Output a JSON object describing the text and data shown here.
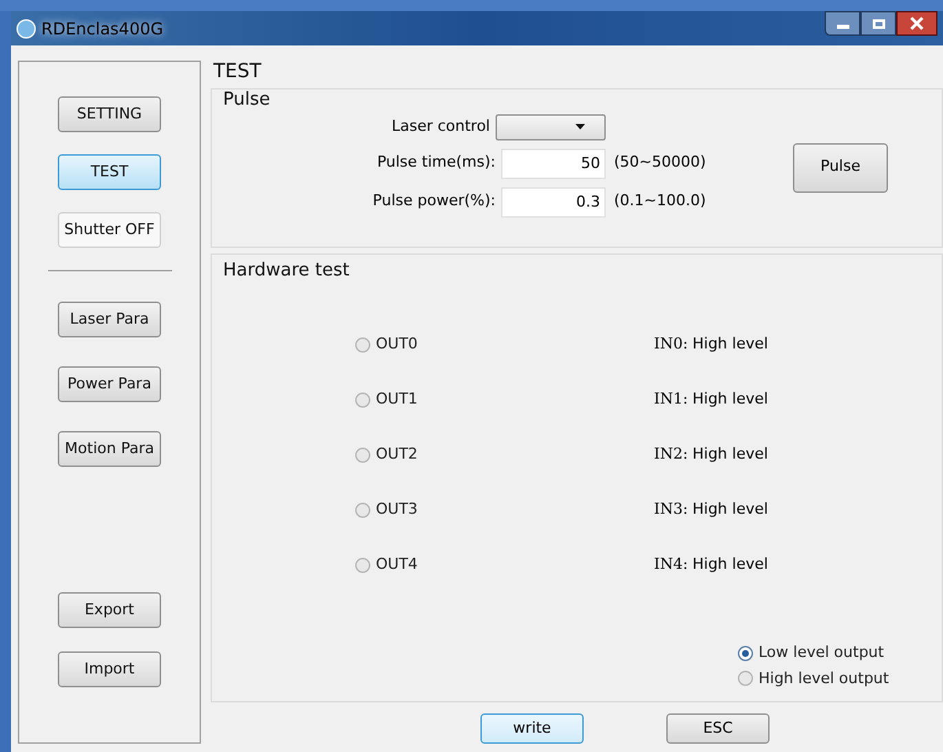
{
  "window": {
    "title": "RDEnclas400G"
  },
  "sidebar": {
    "groups": [
      [
        {
          "label": "SETTING",
          "selected": false,
          "kind": "button"
        },
        {
          "label": "TEST",
          "selected": true,
          "kind": "button"
        },
        {
          "label": "Shutter OFF",
          "selected": false,
          "kind": "flat"
        }
      ],
      [
        {
          "label": "Laser Para",
          "selected": false,
          "kind": "button"
        },
        {
          "label": "Power Para",
          "selected": false,
          "kind": "button"
        },
        {
          "label": "Motion Para",
          "selected": false,
          "kind": "button"
        }
      ],
      [
        {
          "label": "Export",
          "selected": false,
          "kind": "button"
        },
        {
          "label": "Import",
          "selected": false,
          "kind": "button"
        }
      ]
    ]
  },
  "page_title": "TEST",
  "pulse": {
    "title": "Pulse",
    "laser_control": {
      "label": "Laser control"
    },
    "fields": [
      {
        "label": "Pulse time(ms):",
        "value": "50",
        "range": "(50~50000)"
      },
      {
        "label": "Pulse power(%):",
        "value": "0.3",
        "range": "(0.1~100.0)"
      }
    ],
    "button": "Pulse"
  },
  "hardware": {
    "title": "Hardware test",
    "rows": [
      {
        "output": "OUT0",
        "output_selected": false,
        "input": "IN0:",
        "input_state": "High level"
      },
      {
        "output": "OUT1",
        "output_selected": false,
        "input": "IN1:",
        "input_state": "High level"
      },
      {
        "output": "OUT2",
        "output_selected": false,
        "input": "IN2:",
        "input_state": "High level"
      },
      {
        "output": "OUT3",
        "output_selected": false,
        "input": "IN3:",
        "input_state": "High level"
      },
      {
        "output": "OUT4",
        "output_selected": false,
        "input": "IN4:",
        "input_state": "High level"
      }
    ],
    "output_levels": [
      {
        "label": "Low level output",
        "selected": true
      },
      {
        "label": "High level output",
        "selected": false
      }
    ]
  },
  "buttons": [
    {
      "label": "write",
      "kind": "default"
    },
    {
      "label": "ESC",
      "kind": "normal"
    }
  ]
}
